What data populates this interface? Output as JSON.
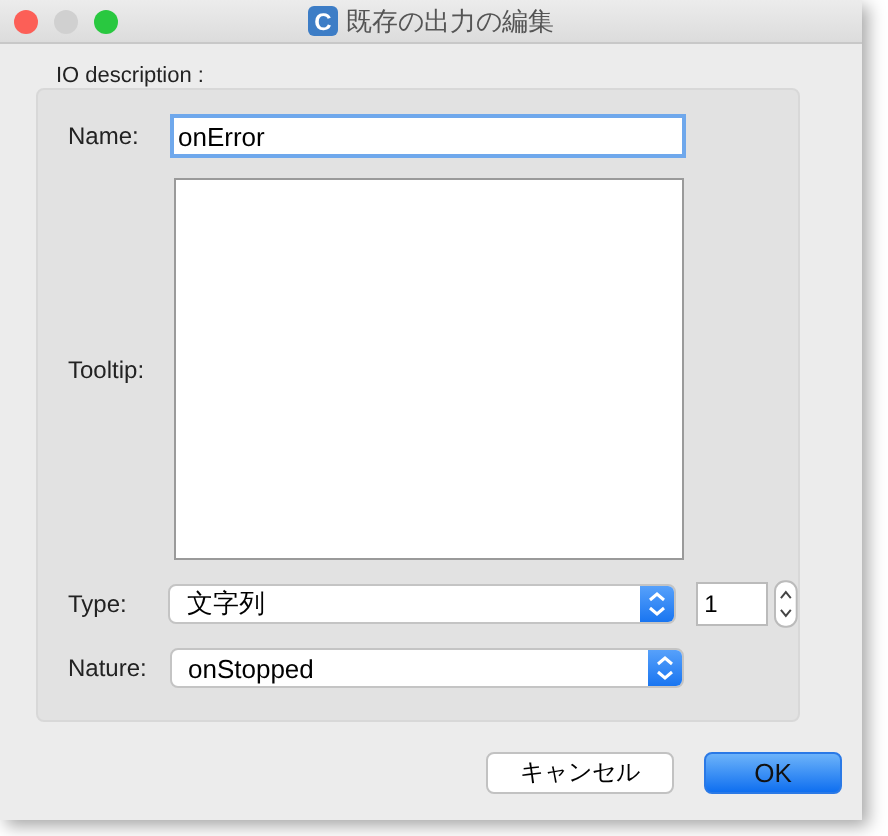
{
  "window": {
    "title": "既存の出力の編集",
    "app_icon_letter": "C"
  },
  "group": {
    "title": "IO description :"
  },
  "name_field": {
    "label": "Name:",
    "value": "onError"
  },
  "tooltip_field": {
    "label": "Tooltip:"
  },
  "type_field": {
    "label": "Type:",
    "value": "文字列",
    "count": "1"
  },
  "nature_field": {
    "label": "Nature:",
    "value": "onStopped"
  },
  "buttons": [
    {
      "label": "キャンセル",
      "default": false
    },
    {
      "label": "OK",
      "default": true
    }
  ]
}
